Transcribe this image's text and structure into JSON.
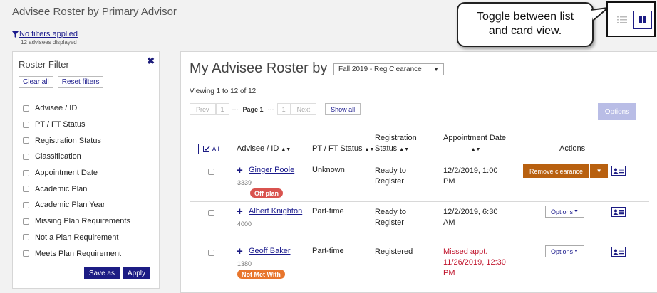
{
  "page": {
    "title": "Advisee Roster by Primary Advisor",
    "filter_link": "No filters applied",
    "advisee_count": "12 advisees displayed"
  },
  "sidebar": {
    "title": "Roster Filter",
    "clear_all": "Clear all",
    "reset_filters": "Reset filters",
    "filters": [
      "Advisee / ID",
      "PT / FT Status",
      "Registration Status",
      "Classification",
      "Appointment Date",
      "Academic Plan",
      "Academic Plan Year",
      "Missing Plan Requirements",
      "Not a Plan Requirement",
      "Meets Plan Requirement"
    ],
    "save_as": "Save as",
    "apply": "Apply"
  },
  "main": {
    "title": "My Advisee Roster by",
    "term": "Fall 2019 - Reg Clearance",
    "viewing": "Viewing 1 to 12 of 12",
    "pager": {
      "prev": "Prev",
      "first": "1",
      "dots": "---",
      "page": "Page 1",
      "last": "1",
      "next": "Next",
      "show_all": "Show all"
    },
    "options": "Options"
  },
  "table": {
    "all": "All",
    "headers": {
      "advisee": "Advisee / ID",
      "status": "PT / FT Status",
      "registration_1": "Registration",
      "registration_2": "Status",
      "appointment": "Appointment Date",
      "actions": "Actions"
    },
    "rows": [
      {
        "name": "Ginger Poole",
        "id": "3339",
        "badge": "Off plan",
        "status": "Unknown",
        "reg_1": "Ready to",
        "reg_2": "Register",
        "appt_1": "12/2/2019, 1:00",
        "appt_2": "PM",
        "action": "Remove clearance"
      },
      {
        "name": "Albert Knighton",
        "id": "4000",
        "status": "Part-time",
        "reg_1": "Ready to",
        "reg_2": "Register",
        "appt_1": "12/2/2019, 6:30",
        "appt_2": "AM",
        "action": "Options"
      },
      {
        "name": "Geoff Baker",
        "id": "1380",
        "badge": "Not Met With",
        "status": "Part-time",
        "reg_1": "Registered",
        "appt_1": "Missed appt.",
        "appt_2": "11/26/2019, 12:30",
        "appt_3": "PM",
        "action": "Options"
      }
    ]
  },
  "callout": {
    "line1": "Toggle between list",
    "line2": "and card view."
  },
  "colors": {
    "navy": "#1c1c84",
    "remove_clearance": "#b8600f",
    "badge_off_plan": "#d9534f",
    "badge_not_met": "#e8762d",
    "missed_appt": "#c0142c"
  },
  "icons": {
    "filter": "funnel-icon",
    "close": "close-x-icon",
    "contact_card": "contact-card-icon",
    "list_view": "list-view-icon",
    "card_view": "card-view-icon"
  }
}
